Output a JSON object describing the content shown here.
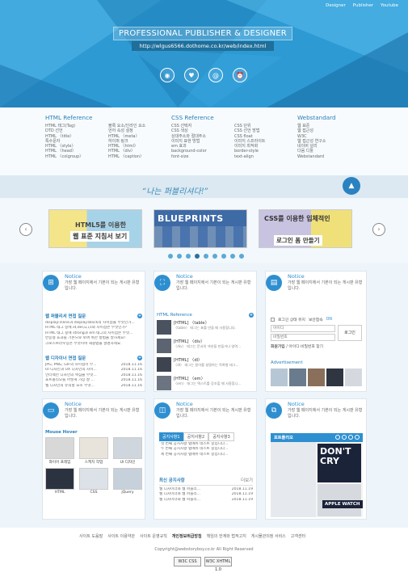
{
  "topnav": [
    "Designer",
    "Publisher",
    "Youtube"
  ],
  "hero": {
    "title": "PROFESSIONAL PUBLISHER & DESIGNER",
    "url": "http://wlgus6566.dothome.co.kr/web/index.html",
    "icons": [
      "target-icon",
      "heart-icon",
      "at-icon",
      "clock-icon"
    ]
  },
  "refs": {
    "html": {
      "title": "HTML Reference",
      "col1": [
        "HTML 태그(Tag)",
        "DTD 선언",
        "HTML 〈title〉",
        "특수문자",
        "HTML 〈style〉",
        "HTML 〈head〉",
        "HTML 〈colgroup〉"
      ],
      "col2": [
        "블록 요소/인라인 요소",
        "언어 속성 설정",
        "HTML 〈meta〉",
        "하이퍼 링크",
        "HTML 〈html〉",
        "HTML 〈div〉",
        "HTML 〈caption〉"
      ]
    },
    "css": {
      "title": "CSS Reference",
      "col1": [
        "CSS 선택자",
        "CSS 색상",
        "상대주소와 절대주소",
        "이미지 표현 방법",
        "em 효과",
        "background-color",
        "font-size"
      ],
      "col2": [
        "CSS 단위",
        "CSS 선언 방법",
        "CSS float",
        "이미지 스프라이트",
        "이미지 최적화",
        "border-style",
        "text-align"
      ]
    },
    "web": {
      "title": "Webstandard",
      "col1": [
        "웹 표준",
        "웹 접근성",
        "W3C",
        "웹 접근성 연구소",
        "네이버 널리",
        "다음 디툴",
        "Webstandard"
      ]
    }
  },
  "slogan": "“나는 퍼블리셔다!”",
  "slider": {
    "slides": [
      {
        "top": "HTML5를 이용한",
        "bottom": "웹 표준 지침서 보기"
      },
      {
        "top": "BLUEPRINTS",
        "bottom": ""
      },
      {
        "top": "CSS를 이용한 입체적인",
        "bottom": "로그인 폼 만들기"
      }
    ],
    "dot_count": 9,
    "active_dot": 3
  },
  "notice": {
    "title": "Notice",
    "desc": "가장 웹 페이지에서 기본이 되는 게시판 유형입니다."
  },
  "col1": {
    "sec1": {
      "title": "웹 퍼블리셔 면접 질문",
      "items": [
        "display:inline과 display:block의 차이점을 무엇인가...",
        "HTML 태그 중에 id,del,u,i,s와 차이점은 무엇인가?",
        "HTML 태그 중에 strong과 em 태그의 차이점은 무엇...",
        "반응형 효과를 기본으로 보여 위한 방법을 말하세요!",
        "크로스브라우징은 무엇이며 해결법을 설명하세요."
      ]
    },
    "sec2": {
      "title": "웹 디자이너 면접 질문",
      "items": [
        [
          "JPG, PNG, GIF의 차이점이 무...",
          "2018.11.16"
        ],
        [
          "UI 디자인과 UX 디자인의 차이...",
          "2018.11.16"
        ],
        [
          "인터랙션 디자인의 핵심을 무엇...",
          "2018.11.16"
        ],
        [
          "포트폴리오를 어떻게 가장 잘 ...",
          "2018.11.16"
        ],
        [
          "웹 디자인의 유의할 요소 무엇...",
          "2018.11.16"
        ]
      ]
    },
    "mouse_hover": {
      "title": "Mouse Hover",
      "items": [
        "와이어 프레임",
        "스케치 작업",
        "UI 디자인",
        "HTML",
        "CSS",
        "jQuery"
      ]
    }
  },
  "col2": {
    "ref": {
      "title": "HTML Reference",
      "items": [
        {
          "t": "[HTML] 〈table〉",
          "d": "〈table〉 태그는 표를 만들 때 사용합니다."
        },
        {
          "t": "[HTML] 〈div〉",
          "d": "〈div〉 태그는 문서의 섹션을 만들거나 영역..."
        },
        {
          "t": "[HTML] 〈dl〉",
          "d": "〈dl〉 태그는 용어를 설명하는 목록형 태그..."
        },
        {
          "t": "[HTML] 〈em〉",
          "d": "〈em〉 태그는 텍스트를 강조할 때 사용합니..."
        }
      ]
    },
    "tabs": [
      "공지사항1",
      "공지사항2",
      "공지사항3"
    ],
    "tab_items": [
      "첫 번째 공지사항 탭메뉴 테스트 중입니다...",
      "두 번째 공지사항 탭메뉴 테스트 중입니다...",
      "세 번째 공지사항 탭메뉴 테스트 중입니다..."
    ],
    "recent": {
      "title": "최신 공지사항",
      "more": "더보기",
      "items": [
        [
          "웹 디자이너와 웹 퍼블리...",
          "2018.11.19"
        ],
        [
          "웹 디자이너와 웹 퍼블리...",
          "2018.11.19"
        ],
        [
          "웹 디자이너와 웹 퍼블리...",
          "2018.11.19"
        ]
      ]
    }
  },
  "col3": {
    "login": {
      "keep": "로그인 상태 유지",
      "secure": "보안접속",
      "secure_state": "ON",
      "id_ph": "아이디",
      "pw_ph": "비밀번호",
      "button": "로그인",
      "join": "회원가입",
      "find": "/ 아이디·비밀번호 찾기"
    },
    "ad": "Advertisement",
    "portfolio": "포트폴리오",
    "dont_cry": "DON'T CRY",
    "apple": "APPLE WATCH"
  },
  "footer": {
    "links": [
      "사이트 도움말",
      "사이트 이용약관",
      "사이트 운영규칙",
      "개인정보취급방침",
      "책임의 한계와 법적고지",
      "게시물관의정 서비스",
      "고객센터"
    ],
    "copyright": "Copyright@webstoryboy.co.kr All Right Reserved",
    "badges": [
      "W3C CSS",
      "W3C XHTML 1.0"
    ]
  },
  "colors": {
    "accent": "#2e8fd0",
    "hero": "#2d9ad4",
    "dark": "#1f6f9a"
  }
}
